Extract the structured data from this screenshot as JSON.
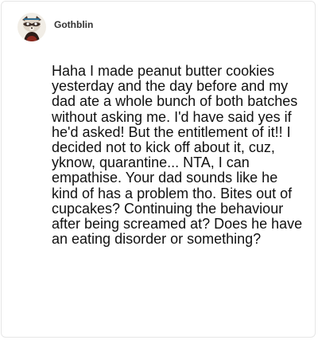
{
  "comment": {
    "username": "Gothblin",
    "avatar_icon": "raccoon-avatar-icon",
    "text": "Haha I made peanut butter cookies yesterday and the day before and my dad ate a whole bunch of both batches without asking me. I'd have said yes if he'd asked! But the entitlement of it!! I decided not to kick off about it, cuz, yknow, quarantine... NTA, I can empathise. Your dad sounds like he kind of has a problem tho. Bites out of cupcakes? Continuing the behaviour after being screamed at? Does he have an eating disorder or something?"
  },
  "colors": {
    "username": "#333333",
    "text": "#111111",
    "border": "#e6e6e6"
  }
}
